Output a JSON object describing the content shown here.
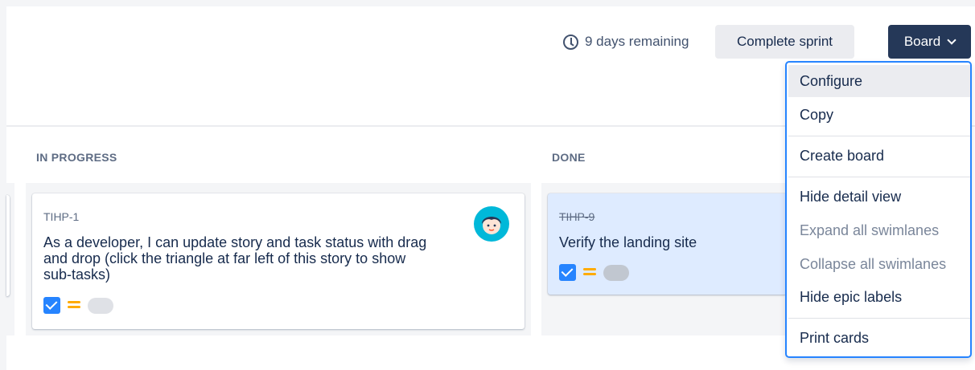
{
  "header": {
    "remaining_text": "9 days remaining",
    "complete_sprint_label": "Complete sprint",
    "board_label": "Board"
  },
  "columns": [
    {
      "title": "IN PROGRESS"
    },
    {
      "title": "DONE"
    }
  ],
  "cards": [
    {
      "key": "TIHP-1",
      "summary_lines": [
        "As a developer, I can update story and task status with drag",
        "and drop (click the triangle at far left of this story to show",
        "sub-tasks)"
      ],
      "done": false
    },
    {
      "key": "TIHP-9",
      "summary_lines": [
        "Verify the landing site"
      ],
      "done": true
    }
  ],
  "board_menu": {
    "items": [
      {
        "label": "Configure",
        "disabled": false
      },
      {
        "label": "Copy",
        "disabled": false
      },
      {
        "label": "Create board",
        "disabled": false
      },
      {
        "label": "Hide detail view",
        "disabled": false
      },
      {
        "label": "Expand all swimlanes",
        "disabled": true
      },
      {
        "label": "Collapse all swimlanes",
        "disabled": true
      },
      {
        "label": "Hide epic labels",
        "disabled": false
      },
      {
        "label": "Print cards",
        "disabled": false
      }
    ]
  },
  "colors": {
    "accent": "#2684ff",
    "board_button": "#253858",
    "priority_medium": "#ffab00",
    "done_card": "#deebff",
    "avatar_bg": "#00b8d9"
  },
  "icons": {
    "remaining": "clock-icon",
    "board_dropdown": "chevron-down-icon",
    "issue_type": "checkbox-task-icon",
    "priority": "priority-medium-icon"
  }
}
